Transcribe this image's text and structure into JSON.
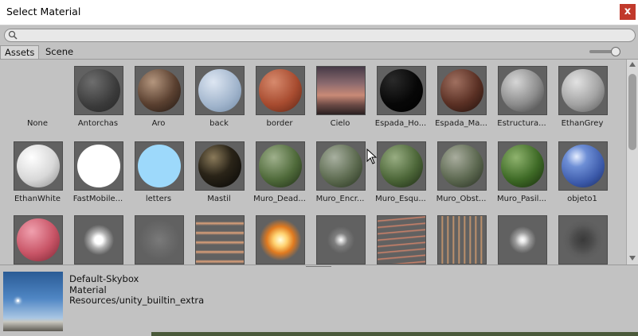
{
  "window": {
    "title": "Select Material",
    "close_label": "x"
  },
  "search": {
    "value": "",
    "placeholder": ""
  },
  "tabs": [
    {
      "label": "Assets",
      "active": true
    },
    {
      "label": "Scene",
      "active": false
    }
  ],
  "materials": [
    {
      "label": "None",
      "icon": "none-slot"
    },
    {
      "label": "Antorchas",
      "icon": "dark-gray-sphere"
    },
    {
      "label": "Aro",
      "icon": "brown-textured-sphere"
    },
    {
      "label": "back",
      "icon": "light-blue-sphere"
    },
    {
      "label": "border",
      "icon": "orange-sphere"
    },
    {
      "label": "Cielo",
      "icon": "sky-texture"
    },
    {
      "label": "Espada_Ho...",
      "icon": "black-sphere"
    },
    {
      "label": "Espada_Ma...",
      "icon": "dark-brown-sphere"
    },
    {
      "label": "Estructura...",
      "icon": "stone-sphere"
    },
    {
      "label": "EthanGrey",
      "icon": "gray-pattern-sphere"
    },
    {
      "label": "EthanWhite",
      "icon": "white-pattern-sphere"
    },
    {
      "label": "FastMobile...",
      "icon": "white-sphere"
    },
    {
      "label": "letters",
      "icon": "cyan-sphere"
    },
    {
      "label": "Mastil",
      "icon": "black-glossy-sphere"
    },
    {
      "label": "Muro_Dead...",
      "icon": "green-stone-sphere"
    },
    {
      "label": "Muro_Encr...",
      "icon": "green-rock-sphere"
    },
    {
      "label": "Muro_Esqu...",
      "icon": "green-wall-sphere"
    },
    {
      "label": "Muro_Obst...",
      "icon": "green-gray-sphere"
    },
    {
      "label": "Muro_Pasil...",
      "icon": "green-moss-sphere"
    },
    {
      "label": "objeto1",
      "icon": "blue-glossy-sphere"
    },
    {
      "label": "",
      "icon": "pink-sphere"
    },
    {
      "label": "",
      "icon": "white-glow-particle"
    },
    {
      "label": "",
      "icon": "smoke-particle"
    },
    {
      "label": "",
      "icon": "orange-streaks-particle"
    },
    {
      "label": "",
      "icon": "fire-explosion-particle"
    },
    {
      "label": "",
      "icon": "small-glow-particle"
    },
    {
      "label": "",
      "icon": "sparks-particle"
    },
    {
      "label": "",
      "icon": "flames-grid-particle"
    },
    {
      "label": "",
      "icon": "soft-glow-particle"
    },
    {
      "label": "",
      "icon": "dark-smoke-particle"
    }
  ],
  "preview": {
    "name": "Default-Skybox",
    "type": "Material",
    "path": "Resources/unity_builtin_extra"
  },
  "colors": {
    "window_bg": "#c2c2c2",
    "thumb_bg": "#616161",
    "close": "#c1392b"
  }
}
